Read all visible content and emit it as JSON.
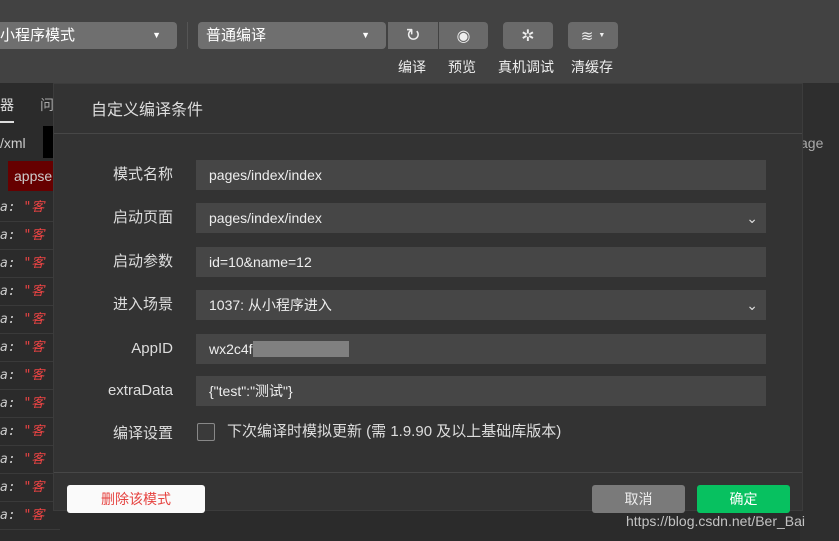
{
  "toolbar": {
    "mode_select": "小程序模式",
    "compile_select": "普通编译",
    "compile_label": "编译",
    "preview_label": "预览",
    "remote_debug_label": "真机调试",
    "clear_cache_label": "清缓存"
  },
  "background": {
    "tab1": "器",
    "tab2": "问",
    "path": "/xml",
    "tag": "appse",
    "right_text": "age",
    "row_prefix": "a:",
    "row_string": "\"客"
  },
  "dialog": {
    "title": "自定义编译条件",
    "fields": [
      {
        "label": "模式名称",
        "value": "pages/index/index"
      },
      {
        "label": "启动页面",
        "value": "pages/index/index"
      },
      {
        "label": "启动参数",
        "value": "id=10&name=12"
      },
      {
        "label": "进入场景",
        "value": "1037: 从小程序进入"
      },
      {
        "label": "AppID",
        "value": "wx2c4f"
      },
      {
        "label": "extraData",
        "value": "{\"test\":\"测试\"}"
      }
    ],
    "settings_label": "编译设置",
    "checkbox_label": "下次编译时模拟更新 (需 1.9.90 及以上基础库版本)",
    "checkbox_checked": false,
    "delete_button": "删除该模式",
    "cancel_button": "取消",
    "confirm_button": "确定"
  },
  "watermark": "https://blog.csdn.net/Ber_Bai",
  "colors": {
    "confirm": "#07c160",
    "delete_text": "#e64340"
  }
}
